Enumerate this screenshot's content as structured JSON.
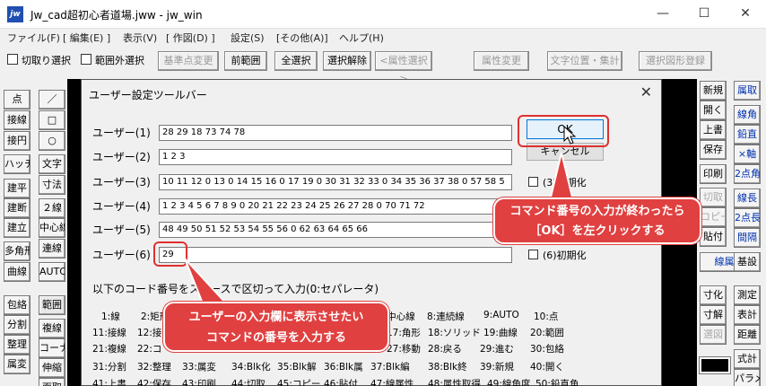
{
  "window": {
    "app_icon": "jw",
    "title": "Jw_cad超初心者道場.jww - jw_win",
    "minimize": "—",
    "maximize": "☐",
    "close": "✕"
  },
  "menu": [
    "ファイル(F)",
    "[ 編集(E) ]",
    "表示(V)",
    "[ 作図(D) ]",
    "設定(S)",
    "[その他(A)]",
    "ヘルプ(H)"
  ],
  "toolbar": {
    "check1": "切取り選択",
    "check2": "範囲外選択",
    "buttons": [
      "基準点変更",
      "前範囲",
      "全選択",
      "選択解除",
      "<属性選択>",
      "属性変更",
      "文字位置・集計",
      "選択図形登録"
    ]
  },
  "left_tools": {
    "col1": [
      "点",
      "接線",
      "接円",
      "ハッチ",
      "建平",
      "建断",
      "建立",
      "多角形",
      "曲線",
      "包絡",
      "分割",
      "整理",
      "属変",
      "",
      ""
    ],
    "col2": [
      "／",
      "□",
      "○",
      "文字",
      "寸法",
      "２線",
      "中心線",
      "連線",
      "AUTO",
      "範囲",
      "複線",
      "コーナー",
      "伸縮",
      "面取"
    ]
  },
  "right_tools": {
    "col1": [
      "新規",
      "開く",
      "上書",
      "保存",
      "印刷",
      "切取",
      "コピー",
      "貼付",
      "",
      "寸化",
      "寸解",
      "選図",
      "",
      ""
    ],
    "col2": [
      "属取",
      "線角",
      "鉛直",
      "×軸",
      "2点角",
      "線長",
      "2点長",
      "間隔",
      "線属性",
      "基設",
      "測定",
      "表計",
      "距離",
      "式計",
      "パラメ"
    ]
  },
  "dialog": {
    "title": "ユーザー設定ツールバー",
    "close": "✕",
    "ok": "OK",
    "cancel": "キャンセル",
    "rows": [
      {
        "label": "ユーザー(1)",
        "value": "28 29 18 73 74 78"
      },
      {
        "label": "ユーザー(2)",
        "value": "1 2 3"
      },
      {
        "label": "ユーザー(3)",
        "value": "10 11 12 0 13 0 14 15 16 0 17 19 0 30 31 32 33 0 34 35 36 37 38 0 57 58 5"
      },
      {
        "label": "ユーザー(4)",
        "value": "1 2 3 4 5 6 7 8 9 0 20 21 22 23 24 25 26 27 28 0 70 71 72"
      },
      {
        "label": "ユーザー(5)",
        "value": "48 49 50 51 52 53 54 55 56 0 62 63 64 65 66"
      },
      {
        "label": "ユーザー(6)",
        "value": "29"
      }
    ],
    "check3": "(3)初期化",
    "check6": "(6)初期化",
    "codes_title": "以下のコード番号をスペースで区切って入力(0:セパレータ)",
    "codes": [
      [
        "1:線",
        "2:矩形",
        "",
        "",
        "",
        "7:中心線",
        "8:連続線",
        "9:AUTO",
        "10:点"
      ],
      [
        "11:接線",
        "12:接",
        "",
        "",
        "",
        "17:角形",
        "18:ソリッド",
        "19:曲線",
        "20:範囲"
      ],
      [
        "21:複線",
        "22:コ",
        "",
        "",
        "",
        "27:移動",
        "28:戻る",
        "29:進む",
        "30:包絡"
      ],
      [
        "31:分割",
        "32:整理",
        "33:属変",
        "34:Blk化",
        "35:Blk解",
        "36:Blk属",
        "37:Blk編",
        "38:Blk終",
        "39:新規",
        "40:開く"
      ],
      [
        "41:上書",
        "42:保存",
        "43:印刷",
        "44:切取",
        "45:コピー",
        "46:貼付",
        "47:線属性",
        "48:属性取得",
        "49:線角度",
        "50:鉛直角"
      ]
    ]
  },
  "annotations": {
    "callout_ok_line1": "コマンド番号の入力が終わったら",
    "callout_ok_line2": "［OK］を左クリックする",
    "callout_input_line1": "ユーザーの入力欄に表示させたい",
    "callout_input_line2": "コマンドの番号を入力する"
  },
  "colors": {
    "callout": "#e04040",
    "accent": "#0078d7"
  }
}
